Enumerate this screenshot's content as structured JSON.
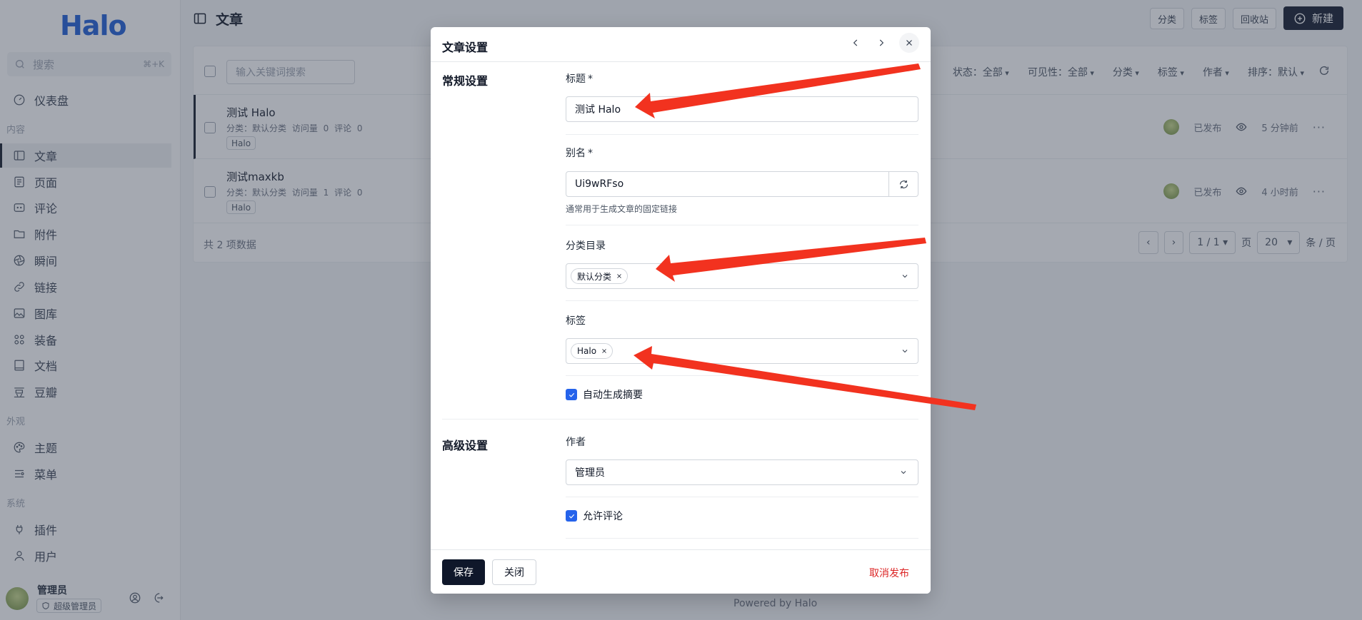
{
  "sidebar": {
    "logo": "Halo",
    "search_placeholder": "搜索",
    "search_shortcut": "⌘+K",
    "dashboard": "仪表盘",
    "section_content": "内容",
    "content_items": [
      "文章",
      "页面",
      "评论",
      "附件",
      "瞬间",
      "链接",
      "图库",
      "装备",
      "文档",
      "豆瓣"
    ],
    "section_appearance": "外观",
    "appearance_items": [
      "主题",
      "菜单"
    ],
    "section_system": "系统",
    "system_items": [
      "插件",
      "用户"
    ],
    "user_name": "管理员",
    "user_role": "超级管理员"
  },
  "topbar": {
    "title": "文章",
    "actions": [
      "分类",
      "标签",
      "回收站"
    ],
    "new_label": "新建"
  },
  "list": {
    "keyword_placeholder": "输入关键词搜索",
    "filters": [
      "状态：全部",
      "可见性：全部",
      "分类",
      "标签",
      "作者",
      "排序：默认"
    ],
    "rows": [
      {
        "title": "测试 Halo",
        "meta": "分类：默认分类 访问量 0 评论 0",
        "tag": "Halo",
        "status": "已发布",
        "time": "5 分钟前"
      },
      {
        "title": "测试maxkb",
        "meta": "分类：默认分类 访问量 1 评论 0",
        "tag": "Halo",
        "status": "已发布",
        "time": "4 小时前"
      }
    ],
    "total": "共 2 项数据",
    "page": "1 / 1",
    "page_label": "页",
    "page_size": "20",
    "page_size_unit": "条 / 页"
  },
  "footer_text": "Powered by Halo",
  "modal": {
    "title": "文章设置",
    "general_section": "常规设置",
    "title_label": "标题",
    "title_value": "测试 Halo",
    "slug_label": "别名",
    "slug_value": "Ui9wRFso",
    "slug_hint": "通常用于生成文章的固定链接",
    "category_label": "分类目录",
    "category_chip": "默认分类",
    "tags_label": "标签",
    "tag_chip": "Halo",
    "auto_excerpt_label": "自动生成摘要",
    "advanced_section": "高级设置",
    "author_label": "作者",
    "author_value": "管理员",
    "allow_comment_label": "允许评论",
    "required_mark": "*",
    "save_label": "保存",
    "close_label": "关闭",
    "unpublish_label": "取消发布"
  },
  "colors": {
    "primary": "#0f172a",
    "checkbox": "#2563eb",
    "danger": "#dc2626",
    "arrow": "#f2321f"
  }
}
